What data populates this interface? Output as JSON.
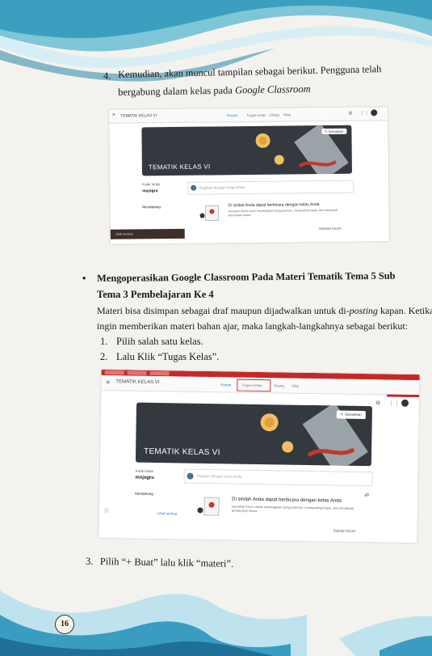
{
  "step4": {
    "number": "4.",
    "line1": "Kemudian, akan muncul tampilan sebagai berikut. Pengguna telah",
    "line2_a": "bergabung dalam kelas pada ",
    "line2_b": "Google Classroom"
  },
  "screenshot1": {
    "class_name": "TEMATIK KELAS VI",
    "tabs": [
      "Forum",
      "Tugas kelas",
      "Orang",
      "Nilai"
    ],
    "banner_title": "TEMATIK KELAS VI",
    "customize": "Sesuaikan",
    "code_label": "Kode kelas",
    "code_value": "mxjsgru",
    "upcoming": "Mendatang",
    "share_prompt": "Bagikan dengan kelas Anda",
    "empty_title": "Di sinilah Anda dapat berbicara dengan kelas Anda",
    "empty_desc": "Gunakan forum untuk membagikan pengumuman, memposting tugas, dan menjawab pertanyaan siswa",
    "stream_settings": "Setelan forum",
    "view_all": "Lihat semua"
  },
  "section": {
    "bullet": "•",
    "heading1": "Mengoperasikan Google Classroom Pada Materi Tematik Tema 5 Sub",
    "heading2": "Tema 3 Pembelajaran Ke 4",
    "para1_a": "Materi bisa disimpan sebagai draf maupun dijadwalkan untuk di-",
    "para1_b": "posting",
    "para1_c": " kapan. Ketika",
    "para2": "ingin memberikan materi bahan ajar, maka langkah-langkahnya sebagai berikut:",
    "items": [
      {
        "n": "1.",
        "text": "Pilih salah satu kelas."
      },
      {
        "n": "2.",
        "text": "Lalu Klik “Tugas Kelas”."
      }
    ]
  },
  "screenshot2": {
    "class_name": "TEMATIK KELAS VI",
    "tabs": [
      "Forum",
      "Tugas Kelas",
      "Orang",
      "Nilai"
    ],
    "banner_title": "TEMATIK KELAS VI",
    "customize": "Sesuaikan",
    "code_label": "Kode kelas",
    "code_value": "mxjsgru",
    "upcoming": "Mendatang",
    "share_prompt": "Bagikan dengan kelas Anda",
    "empty_title": "Di sinilah Anda dapat berbicara dengan kelas Anda",
    "empty_desc": "Gunakan forum untuk membagikan pengumuman, memposting tugas, dan menjawab pertanyaan siswa",
    "stream_settings": "Setelan forum",
    "view_all": "Lihat semua",
    "highlight_color": "#d32f2f"
  },
  "step3": {
    "number": "3.",
    "text_a": "Pilih “+ Buat”",
    "text_b": " lalu klik “materi”."
  },
  "page_number": "16"
}
